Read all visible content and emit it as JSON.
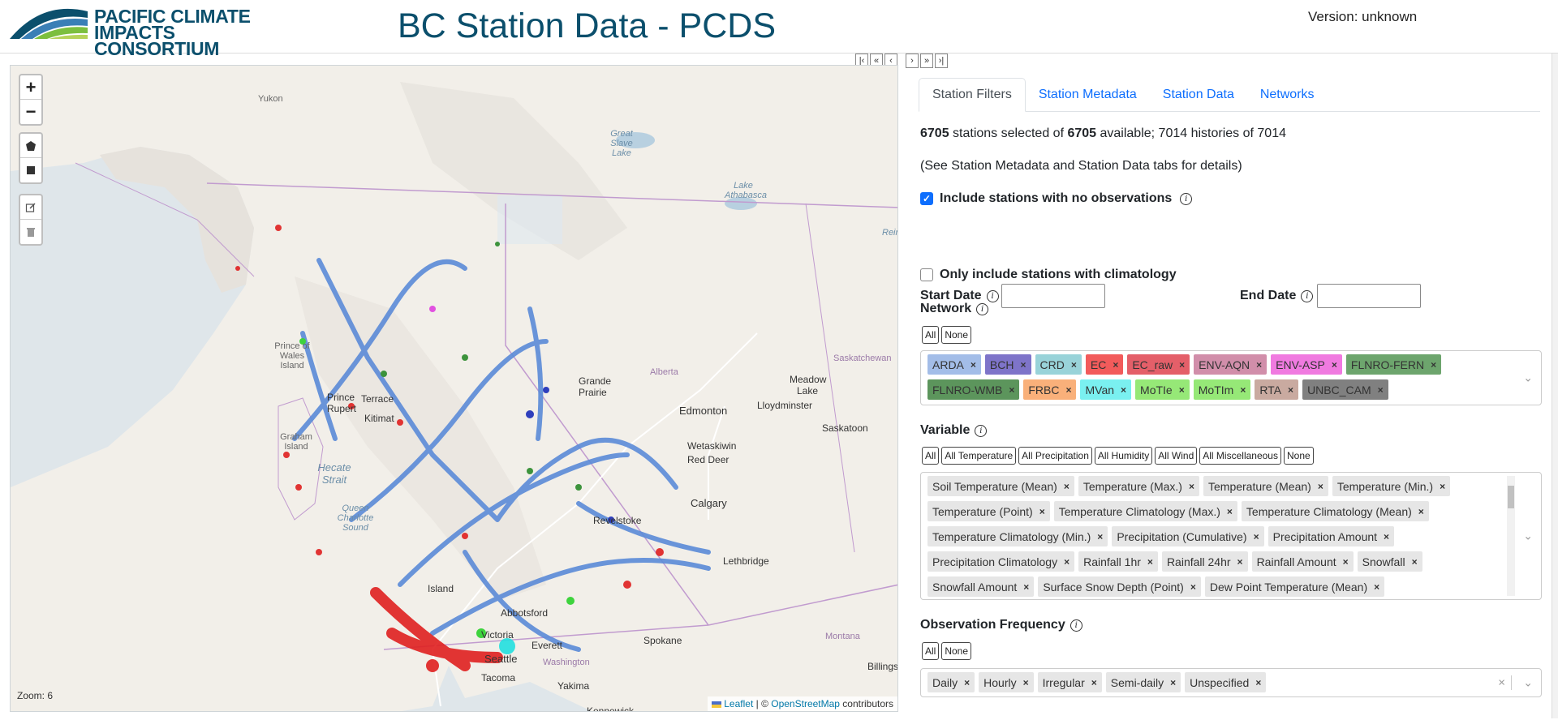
{
  "header": {
    "logo_line1": "PACIFIC CLIMATE",
    "logo_line2": "IMPACTS CONSORTIUM",
    "title": "BC Station Data - PCDS",
    "version": "Version: unknown"
  },
  "splitter": {
    "buttons": [
      "|‹",
      "«",
      "‹",
      "›",
      "»",
      "›|"
    ]
  },
  "map": {
    "zoom_in": "+",
    "zoom_out": "−",
    "zoom_text": "Zoom: 6",
    "attribution": {
      "leaflet": "Leaflet",
      "sep": " | © ",
      "osm": "OpenStreetMap",
      "suffix": " contributors"
    },
    "labels": {
      "yukon": "Yukon",
      "great_slave_lake": "Great Slave Lake",
      "lake_athabasca": "Lake Athabasca",
      "reindeer": "Rein",
      "prince_of_wales": "Prince of Wales Island",
      "saskatchewan": "Saskatchewan",
      "prince_rupert": "Prince Rupert",
      "terrace": "Terrace",
      "kitimat": "Kitimat",
      "grande_prairie": "Grande Prairie",
      "alberta": "Alberta",
      "meadow_lake": "Meadow Lake",
      "edmonton": "Edmonton",
      "lloydminster": "Lloydminster",
      "graham_island": "Graham Island",
      "hecate_strait": "Hecate Strait",
      "saskatoon": "Saskatoon",
      "wetaskiwin": "Wetaskiwin",
      "red_deer": "Red Deer",
      "queen_charlotte_sound": "Queen Charlotte Sound",
      "calgary": "Calgary",
      "revelstoke": "Revelstoke",
      "lethbridge": "Lethbridge",
      "island": "Island",
      "abbotsford": "Abbotsford",
      "victoria": "Victoria",
      "everett": "Everett",
      "spokane": "Spokane",
      "montana": "Montana",
      "seattle": "Seattle",
      "washington": "Washington",
      "tacoma": "Tacoma",
      "yakima": "Yakima",
      "kennewick": "Kennewick",
      "billings": "Billings"
    }
  },
  "tabs": [
    "Station Filters",
    "Station Metadata",
    "Station Data",
    "Networks"
  ],
  "filters": {
    "selected_count": "6705",
    "selected_text": " stations selected of ",
    "available_count": "6705",
    "available_text": " available; 7014 histories of 7014",
    "note": "(See Station Metadata and Station Data tabs for details)",
    "include_no_obs": "Include stations with no observations",
    "start_date_label": "Start Date",
    "end_date_label": "End Date",
    "start_date_value": "",
    "end_date_value": "",
    "climatology_only": "Only include stations with climatology",
    "network_title": "Network",
    "network_buttons": [
      "All",
      "None"
    ],
    "networks": [
      {
        "label": "ARDA",
        "color": "#a3bde8"
      },
      {
        "label": "BCH",
        "color": "#7e74c9"
      },
      {
        "label": "CRD",
        "color": "#99d3d9"
      },
      {
        "label": "EC",
        "color": "#f25b5b"
      },
      {
        "label": "EC_raw",
        "color": "#e45f69"
      },
      {
        "label": "ENV-AQN",
        "color": "#d18eaa"
      },
      {
        "label": "ENV-ASP",
        "color": "#f07ae0"
      },
      {
        "label": "FLNRO-FERN",
        "color": "#6da56d"
      },
      {
        "label": "FLNRO-WMB",
        "color": "#5c955c"
      },
      {
        "label": "FRBC",
        "color": "#f9b07a"
      },
      {
        "label": "MVan",
        "color": "#7af0f0"
      },
      {
        "label": "MoTIe",
        "color": "#96e877"
      },
      {
        "label": "MoTIm",
        "color": "#96e877"
      },
      {
        "label": "RTA",
        "color": "#c9aaa0"
      },
      {
        "label": "UNBC_CAM",
        "color": "#808080"
      }
    ],
    "variable_title": "Variable",
    "variable_buttons": [
      "All",
      "All Temperature",
      "All Precipitation",
      "All Humidity",
      "All Wind",
      "All Miscellaneous",
      "None"
    ],
    "variables": [
      "Soil Temperature (Mean)",
      "Temperature (Max.)",
      "Temperature (Mean)",
      "Temperature (Min.)",
      "Temperature (Point)",
      "Temperature Climatology (Max.)",
      "Temperature Climatology (Mean)",
      "Temperature Climatology (Min.)",
      "Precipitation (Cumulative)",
      "Precipitation Amount",
      "Precipitation Climatology",
      "Rainfall 1hr",
      "Rainfall 24hr",
      "Rainfall Amount",
      "Snowfall",
      "Snowfall Amount",
      "Surface Snow Depth (Point)",
      "Dew Point Temperature (Mean)"
    ],
    "frequency_title": "Observation Frequency",
    "frequency_buttons": [
      "All",
      "None"
    ],
    "frequencies": [
      "Daily",
      "Hourly",
      "Irregular",
      "Semi-daily",
      "Unspecified"
    ],
    "chip_remove": "×",
    "clear_icon": "×",
    "dropdown_icon": "⌄"
  }
}
